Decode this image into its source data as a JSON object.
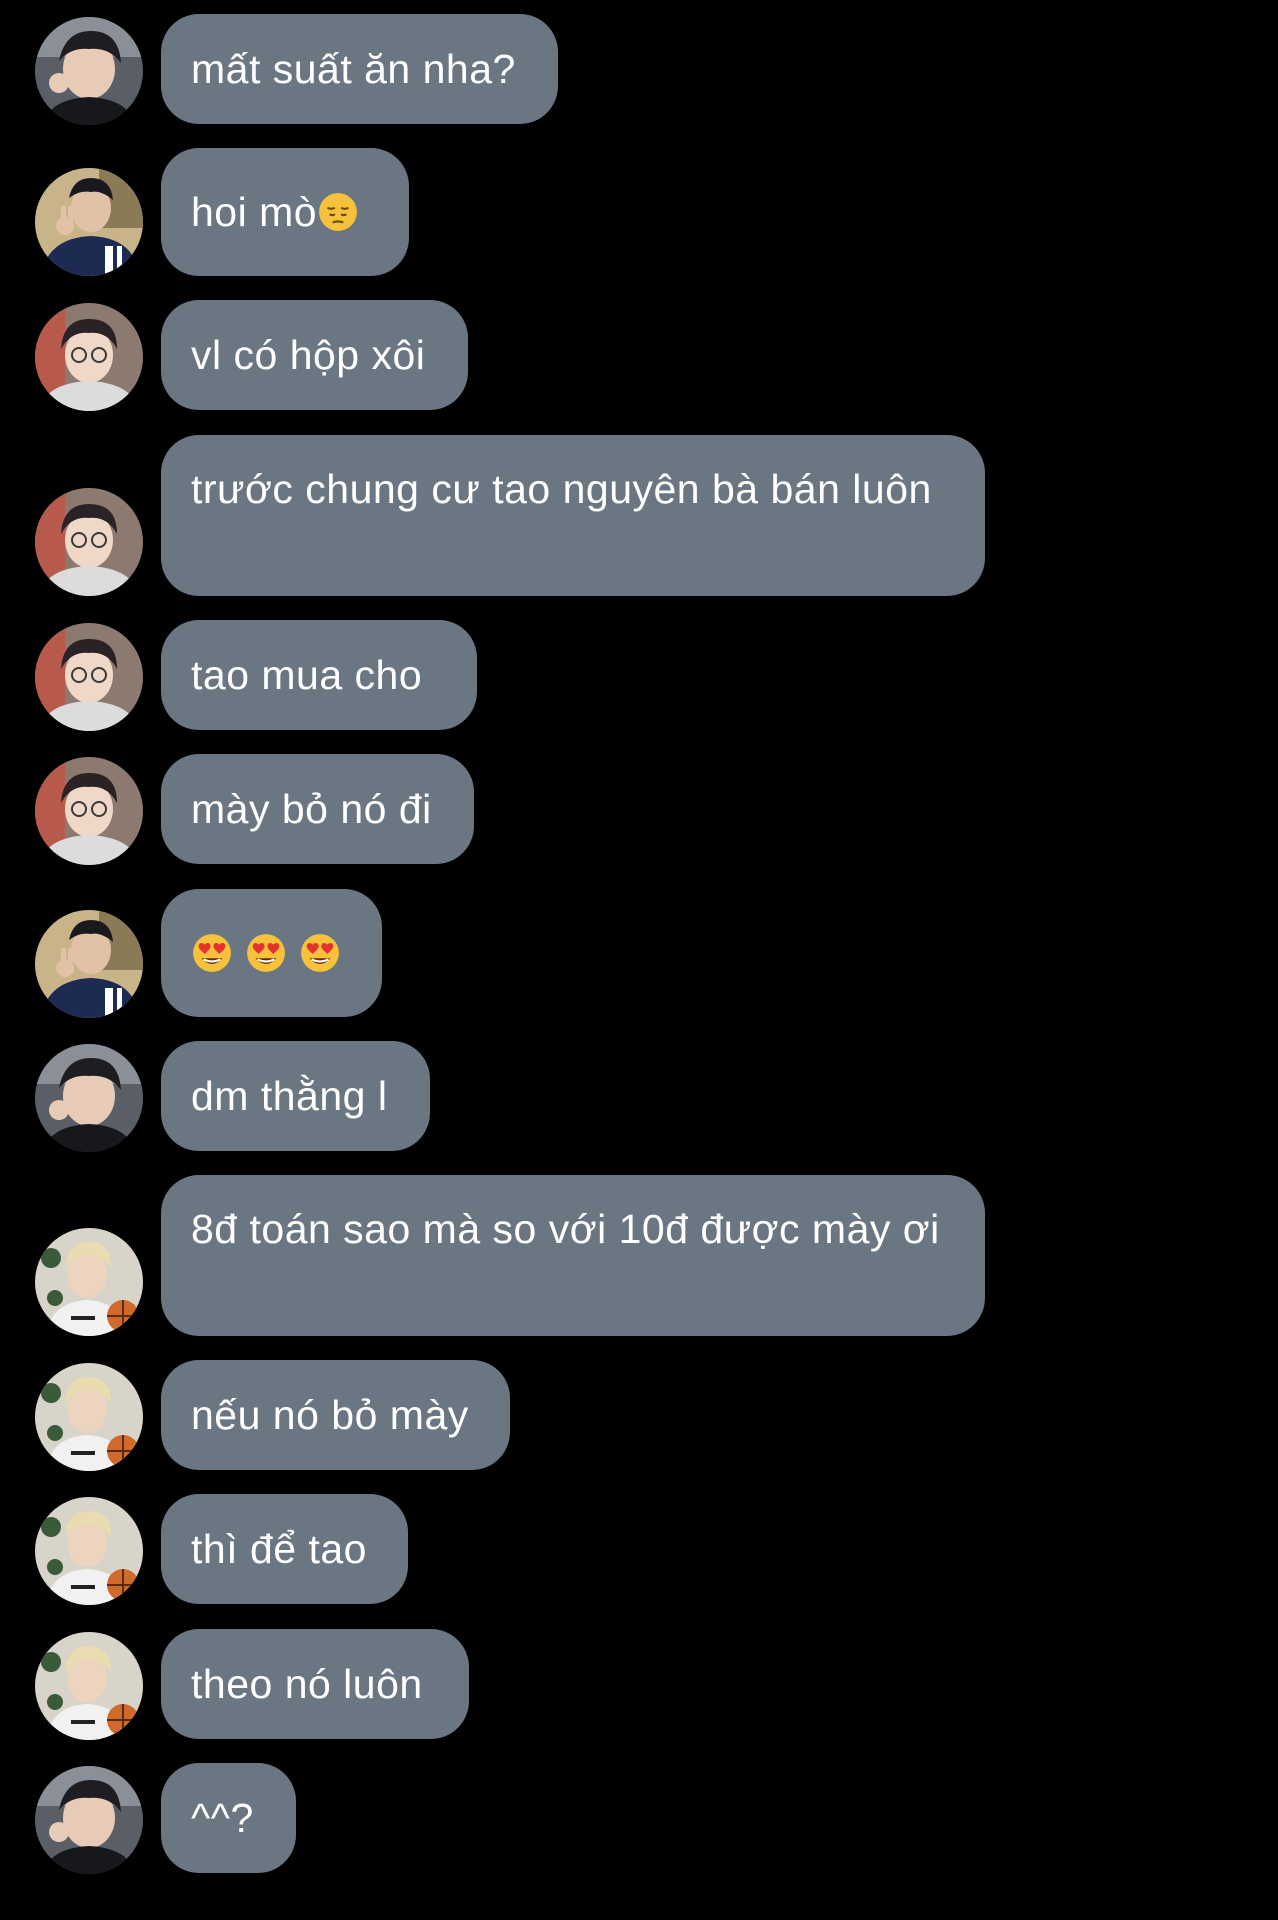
{
  "chat": {
    "messages": [
      {
        "sender": "user-a",
        "text": "mất suất ăn nha?"
      },
      {
        "sender": "user-b",
        "text": "hoi mò",
        "emoji": "pensive-face"
      },
      {
        "sender": "user-c",
        "text": "vl có hộp xôi"
      },
      {
        "sender": "user-c",
        "text": "trước chung cư tao nguyên bà bán luôn"
      },
      {
        "sender": "user-c",
        "text": "tao mua cho"
      },
      {
        "sender": "user-c",
        "text": "mày bỏ nó đi"
      },
      {
        "sender": "user-b",
        "text": "",
        "emoji": "heart-eyes-face x3"
      },
      {
        "sender": "user-a",
        "text": "dm thằng l"
      },
      {
        "sender": "user-d",
        "text": "8đ toán sao mà so với 10đ được mày ơi"
      },
      {
        "sender": "user-d",
        "text": "nếu nó bỏ mày"
      },
      {
        "sender": "user-d",
        "text": "thì để tao"
      },
      {
        "sender": "user-d",
        "text": "theo nó luôn"
      },
      {
        "sender": "user-a",
        "text": "^^?"
      }
    ]
  },
  "colors": {
    "background": "#000000",
    "bubble": "#6b7683",
    "text": "#ffffff"
  }
}
